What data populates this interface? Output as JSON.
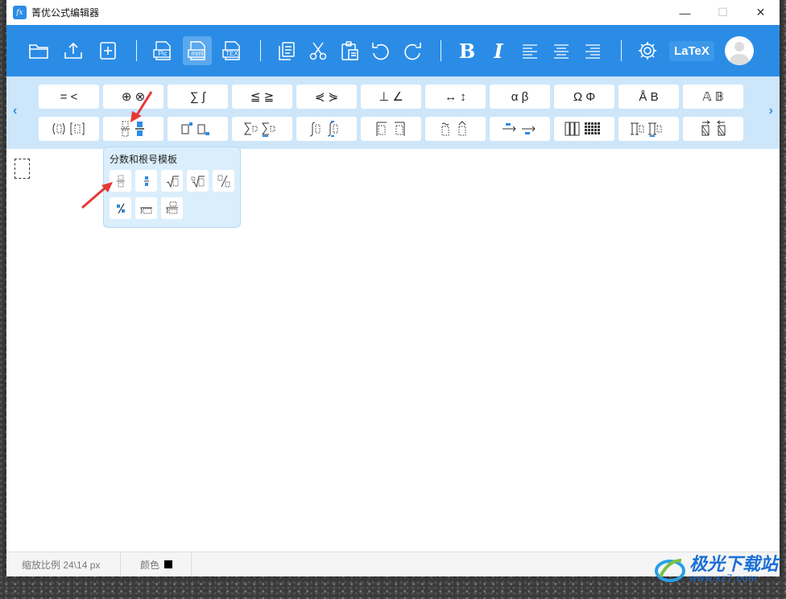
{
  "app": {
    "title": "菁优公式编辑器",
    "icon": "fx"
  },
  "window_controls": {
    "minimize": "—",
    "maximize": "☐",
    "close": "✕"
  },
  "toolbar": {
    "open_icon": "folder-open-icon",
    "upload_icon": "upload-icon",
    "new_icon": "new-file-icon",
    "export_pic_label": "Pic",
    "export_mml_label": "mml",
    "export_tex_label": "TEX",
    "bold_label": "B",
    "italic_label": "I",
    "latex_label": "LaTeX"
  },
  "palette": {
    "row1": [
      "= <",
      "⊕ ⊗",
      "∑ ∫",
      "≦ ≧",
      "⋞ ⋟",
      "⊥ ∠",
      "↔ ↕",
      "α β",
      "Ω Φ",
      "Å B",
      "𝔸 𝔹"
    ],
    "left_arrow": "‹",
    "right_arrow": "›"
  },
  "popup": {
    "title": "分数和根号模板"
  },
  "status": {
    "zoom_label": "缩放比例 24\\14 px",
    "color_label": "颜色"
  },
  "watermark": {
    "name": "极光下载站",
    "url": "www.xz7.com"
  },
  "colors": {
    "accent": "#2b8ce6",
    "palette_bg": "#cde6fa",
    "arrow": "#e53935"
  }
}
